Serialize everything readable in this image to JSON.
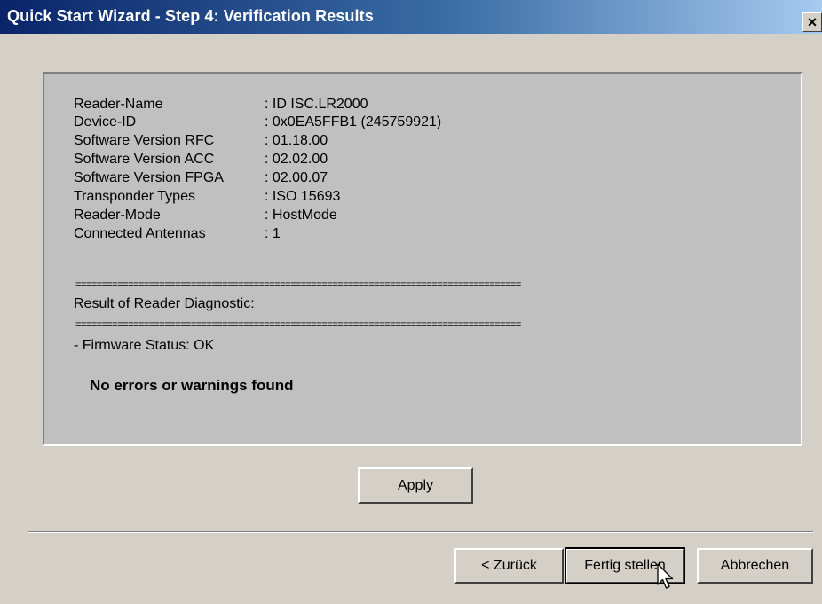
{
  "window": {
    "title": "Quick Start Wizard - Step 4: Verification Results",
    "close_glyph": "×"
  },
  "reader_info": [
    {
      "label": "Reader-Name",
      "value": ": ID ISC.LR2000"
    },
    {
      "label": "Device-ID",
      "value": ": 0x0EA5FFB1 (245759921)"
    },
    {
      "label": "Software Version RFC",
      "value": ": 01.18.00"
    },
    {
      "label": "Software Version ACC",
      "value": ": 02.02.00"
    },
    {
      "label": "Software Version FPGA",
      "value": ": 02.00.07"
    },
    {
      "label": "Transponder Types",
      "value": ": ISO 15693"
    },
    {
      "label": "Reader-Mode",
      "value": ": HostMode"
    },
    {
      "label": "Connected Antennas",
      "value": ": 1"
    }
  ],
  "diagnostic": {
    "separator": "=====================================================================================",
    "heading": "Result of Reader Diagnostic:",
    "firmware_status": "- Firmware Status: OK",
    "summary": "No errors or warnings found"
  },
  "buttons": {
    "apply": "Apply",
    "back": "< Zurück",
    "finish": "Fertig stellen",
    "cancel": "Abbrechen"
  },
  "colors": {
    "title_bar_start": "#0a246a",
    "title_bar_end": "#a6caf0",
    "dialog_bg": "#d4d0c8",
    "panel_bg": "#c0c0c0"
  },
  "icons": {
    "cursor": "mouse-pointer-icon"
  }
}
